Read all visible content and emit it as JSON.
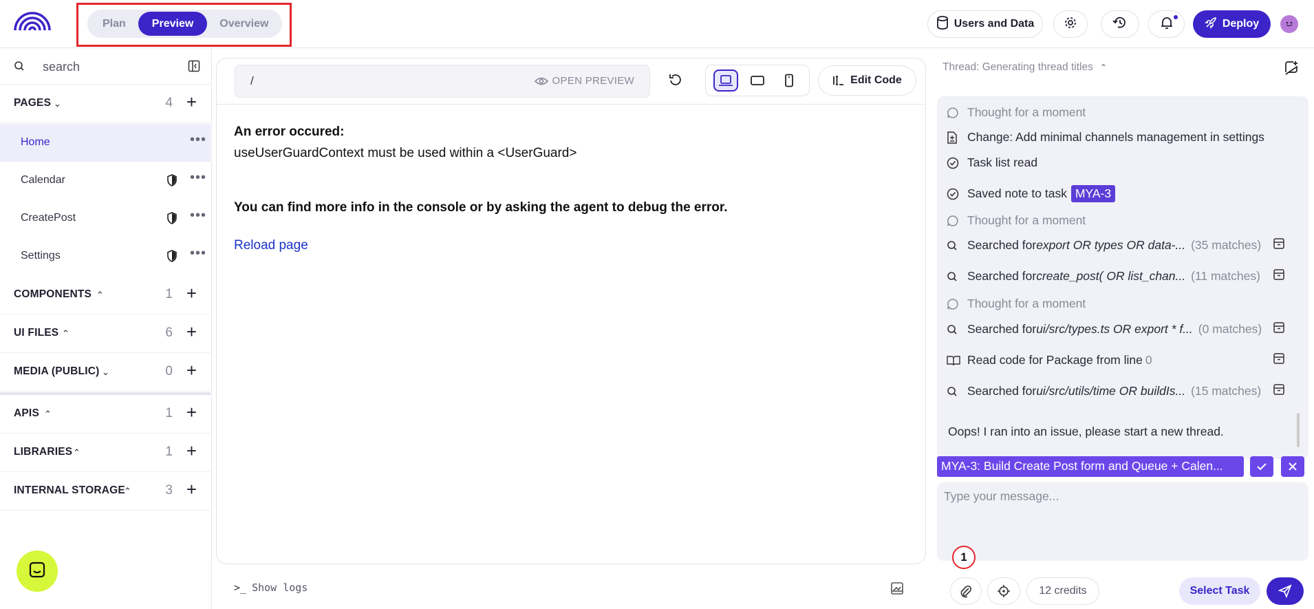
{
  "topbar": {
    "tabs": [
      {
        "label": "Plan",
        "active": false
      },
      {
        "label": "Preview",
        "active": true
      },
      {
        "label": "Overview",
        "active": false
      }
    ],
    "users_and_data": "Users and Data",
    "deploy": "Deploy"
  },
  "sidebar": {
    "search_placeholder": "search",
    "pages": {
      "title": "PAGES",
      "count": "4"
    },
    "page_items": [
      {
        "label": "Home",
        "active": true
      },
      {
        "label": "Calendar",
        "protected": true
      },
      {
        "label": "CreatePost",
        "protected": true
      },
      {
        "label": "Settings",
        "protected": true
      }
    ],
    "sections": [
      {
        "title": "COMPONENTS",
        "count": "1"
      },
      {
        "title": "UI FILES",
        "count": "6"
      },
      {
        "title": "MEDIA (PUBLIC)",
        "count": "0"
      },
      {
        "title": "APIS",
        "count": "1"
      },
      {
        "title": "LIBRARIES",
        "count": "1"
      },
      {
        "title": "INTERNAL STORAGE",
        "count": "3"
      }
    ]
  },
  "preview": {
    "path": "/",
    "open_preview": "OPEN PREVIEW",
    "edit_code": "Edit Code",
    "error_title": "An error occured:",
    "error_message": "useUserGuardContext must be used within a <UserGuard>",
    "error_info": "You can find more info in the console or by asking the agent to debug the error.",
    "reload": "Reload page",
    "show_logs": "Show logs"
  },
  "thread": {
    "title": "Thread: Generating thread titles",
    "messages": [
      {
        "icon": "thought-bubble-icon",
        "text": "Thought for a moment",
        "muted": true
      },
      {
        "icon": "file-change-icon",
        "text": "Change: Add minimal channels management in settings"
      },
      {
        "icon": "check-circle-icon",
        "text": "Task list read"
      },
      {
        "icon": "check-circle-icon",
        "text": "Saved note to task",
        "tag": "MYA-3"
      },
      {
        "icon": "thought-bubble-icon",
        "text": "Thought for a moment",
        "muted": true
      },
      {
        "icon": "search-icon",
        "prefix": "Searched for ",
        "query": "export OR types OR data-...",
        "result": "(35 matches)"
      },
      {
        "icon": "search-icon",
        "prefix": "Searched for ",
        "query": "create_post( OR list_chan...",
        "result": "(11 matches)"
      },
      {
        "icon": "thought-bubble-icon",
        "text": "Thought for a moment",
        "muted": true
      },
      {
        "icon": "search-icon",
        "prefix": "Searched for ",
        "query": "ui/src/types.ts OR export * f...",
        "result": "(0 matches)"
      },
      {
        "icon": "book-icon",
        "prefix": "Read code for Package from line ",
        "result": "0"
      },
      {
        "icon": "search-icon",
        "prefix": "Searched for ",
        "query": "ui/src/utils/time OR buildIs...",
        "result": "(15 matches)"
      }
    ],
    "error_reply": "Oops! I ran into an issue, please start a new thread.",
    "task_chip": "MYA-3: Build Create Post form and Queue + Calen...",
    "composer_placeholder": "Type your message...",
    "attach_badge": "1",
    "credits": "12 credits",
    "select_task": "Select Task"
  },
  "colors": {
    "accent": "#3c24c9",
    "task": "#6b47ea",
    "highlight": "#e3262d",
    "help": "#d7f73a"
  }
}
